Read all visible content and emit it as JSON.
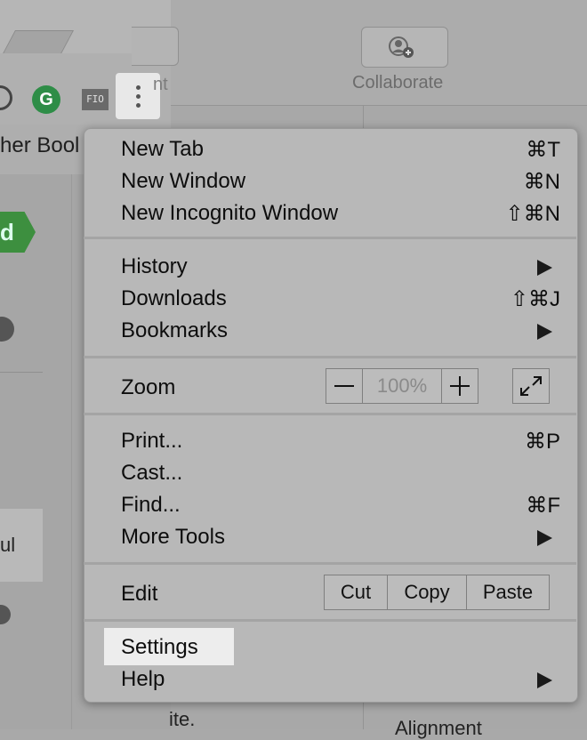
{
  "background": {
    "bookmarks_bar_text": "her Bool",
    "grammarly_icon_text": "G",
    "fio_icon_text": "FIO",
    "green_tag_text": "d",
    "left_list_text": "ul",
    "partial_button_text": "nt",
    "collaborate_label": "Collaborate",
    "bottom_text": "ite.",
    "bottom_right_text": "Alignment"
  },
  "menu": {
    "new_tab": {
      "label": "New Tab",
      "shortcut": "⌘T"
    },
    "new_window": {
      "label": "New Window",
      "shortcut": "⌘N"
    },
    "new_incognito": {
      "label": "New Incognito Window",
      "shortcut": "⇧⌘N"
    },
    "history": {
      "label": "History"
    },
    "downloads": {
      "label": "Downloads",
      "shortcut": "⇧⌘J"
    },
    "bookmarks": {
      "label": "Bookmarks"
    },
    "zoom": {
      "label": "Zoom",
      "value": "100%"
    },
    "print": {
      "label": "Print...",
      "shortcut": "⌘P"
    },
    "cast": {
      "label": "Cast..."
    },
    "find": {
      "label": "Find...",
      "shortcut": "⌘F"
    },
    "more_tools": {
      "label": "More Tools"
    },
    "edit": {
      "label": "Edit",
      "cut": "Cut",
      "copy": "Copy",
      "paste": "Paste"
    },
    "settings": {
      "label": "Settings"
    },
    "help": {
      "label": "Help"
    }
  },
  "colors": {
    "menu_bg": "#b8b8b8",
    "highlight": "#ededed",
    "grammarly_green": "#2e8d47"
  }
}
